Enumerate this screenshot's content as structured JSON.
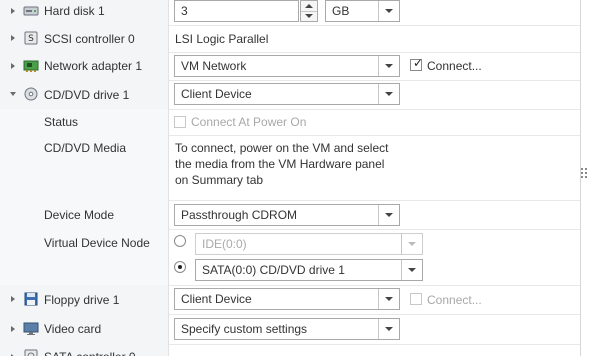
{
  "rows": {
    "hard_disk": {
      "label": "Hard disk 1",
      "icon": "hard-disk-icon",
      "size_value": "3",
      "unit": "GB"
    },
    "scsi": {
      "label": "SCSI controller 0",
      "icon": "scsi-controller-icon",
      "value": "LSI Logic Parallel"
    },
    "network": {
      "label": "Network adapter 1",
      "icon": "network-adapter-icon",
      "value": "VM Network",
      "connect_label": "Connect...",
      "connect_checked": true
    },
    "cddvd": {
      "label": "CD/DVD drive 1",
      "icon": "cd-dvd-icon",
      "value": "Client Device"
    },
    "status": {
      "label": "Status",
      "checkbox_label": "Connect At Power On"
    },
    "media": {
      "label": "CD/DVD Media",
      "text_line1": "To connect, power on the VM and select",
      "text_line2": "the media from the VM Hardware panel",
      "text_line3": "on Summary tab"
    },
    "device_mode": {
      "label": "Device Mode",
      "value": "Passthrough CDROM"
    },
    "vdn": {
      "label": "Virtual Device Node",
      "option1": "IDE(0:0)",
      "option2": "SATA(0:0) CD/DVD drive 1",
      "selected": "option2"
    },
    "floppy": {
      "label": "Floppy drive 1",
      "icon": "floppy-drive-icon",
      "value": "Client Device",
      "connect_label": "Connect..."
    },
    "video": {
      "label": "Video card",
      "icon": "video-card-icon",
      "value": "Specify custom settings"
    },
    "sata": {
      "label": "SATA controller 0",
      "icon": "sata-controller-icon"
    }
  },
  "colors": {
    "label_bg": "#f3f5f7",
    "border": "#a9a9a9",
    "text": "#333333",
    "muted": "#a8a8a8"
  }
}
